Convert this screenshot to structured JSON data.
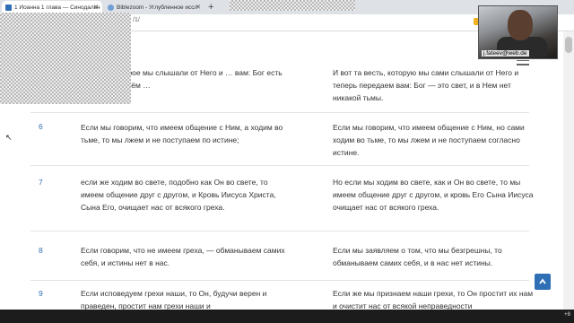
{
  "browser": {
    "tabs": [
      {
        "label": "1 Иоанна 1 глава — Синодальн",
        "active": true,
        "icon_color": "#2f6fb5"
      },
      {
        "label": "Biblezoom - Углубленное иссл",
        "active": false,
        "icon_color": "#6e9fd6"
      }
    ],
    "new_tab_label": "+",
    "url_fragment": "/1/"
  },
  "webcam": {
    "label": "j.fateev@web.de"
  },
  "verses": [
    {
      "number": "",
      "syn": "…естие, которое мы слышали от Него и … вам: Бог есть свет, и нет в Нём …",
      "modern": "И вот та весть, которую мы сами слышали от Него и теперь передаем вам: Бог — это свет, и в Нем нет никакой тьмы."
    },
    {
      "number": "6",
      "syn": "Если мы говорим, что имеем общение с Ним, а ходим во тьме, то мы лжем и не поступаем по истине;",
      "modern": "Если мы говорим, что имеем общение с Ним, но сами ходим во тьме, то мы лжем и не поступаем согласно истине."
    },
    {
      "number": "7",
      "syn": "если же ходим во свете, подобно как Он во свете, то имеем общение друг с другом, и Кровь Иисуса Христа, Сына Его, очищает нас от всякого греха.",
      "modern": "Но если мы ходим во свете, как и Он во свете, то мы имеем общение друг с другом, и кровь Его Сына Иисуса очищает нас от всякого греха."
    },
    {
      "number": "8",
      "syn": "Если говорим, что не имеем греха, — обманываем самих себя, и истины нет в нас.",
      "modern": "Если мы заявляем о том, что мы безгрешны, то обманываем самих себя, и в нас нет истины."
    },
    {
      "number": "9",
      "syn": "Если исповедуем грехи наши, то Он, будучи верен и праведен, простит нам грехи наши и",
      "modern": "Если же мы признаем наши грехи, то Он простит их нам и очистит нас от всякой неправедности"
    }
  ],
  "back_to_top_icon": "chevron-up-icon",
  "tray_text": "+8"
}
